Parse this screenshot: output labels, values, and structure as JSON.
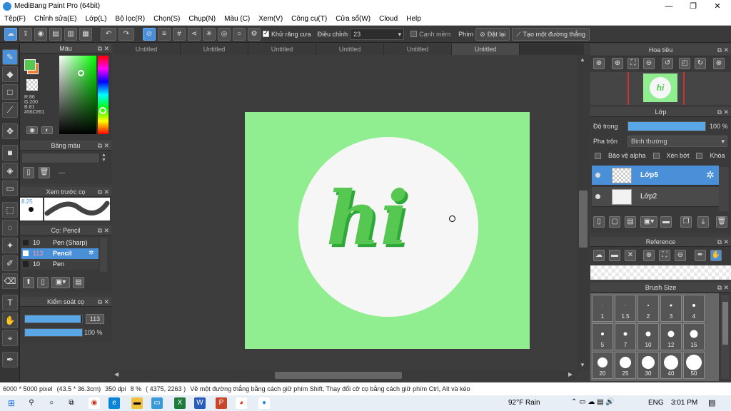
{
  "app": {
    "title": "MediBang Paint Pro (64bit)"
  },
  "menu": [
    "Tệp(F)",
    "Chỉnh sửa(E)",
    "Lớp(L)",
    "Bộ lọc(R)",
    "Chọn(S)",
    "Chụp(N)",
    "Màu (C)",
    "Xem(V)",
    "Công cụ(T)",
    "Cửa sổ(W)",
    "Cloud",
    "Help"
  ],
  "toolbar": {
    "antialias_label": "Khử răng cưa",
    "correction_label": "Điều chỉnh",
    "correction_value": "23",
    "soft_edge_label": "Cạnh mềm",
    "key_label": "Phím",
    "reset_label": "Đặt lại",
    "make_line_label": "Tạo một đường thẳng"
  },
  "tabs": [
    "Untitled",
    "Untitled",
    "Untitled",
    "Untitled",
    "Untitled",
    "Untitled"
  ],
  "color_panel": {
    "title": "Màu",
    "r": "R:86",
    "g": "G:200",
    "b": "B:81",
    "hex": "#56C851",
    "primary_color": "#56C851",
    "secondary_color": "#f07a30"
  },
  "palette_panel": {
    "title": "Bảng màu",
    "empty_label": "---"
  },
  "brush_preview_panel": {
    "title": "Xem trước cọ",
    "size_label": "8.25"
  },
  "brush_panel": {
    "title": "Cọ: Pencil",
    "items": [
      {
        "size": "10",
        "name": "Pen (Sharp)"
      },
      {
        "size": "113",
        "name": "Pencil"
      },
      {
        "size": "10",
        "name": "Pen"
      }
    ]
  },
  "brush_control_panel": {
    "title": "Kiểm soát cọ",
    "size_value": "113",
    "opacity_value": "100 %",
    "size_fraction": 0.97,
    "opacity_fraction": 1.0
  },
  "navigator_panel": {
    "title": "Hoa tiêu"
  },
  "layer_panel": {
    "title": "Lớp",
    "opacity_label": "Độ trong",
    "opacity_value": "100 %",
    "opacity_fraction": 1.0,
    "blend_label": "Pha trộn",
    "blend_value": "Bình thường",
    "protect_alpha": "Bảo vệ alpha",
    "clipping": "Xén bớt",
    "lock": "Khóa",
    "layers": [
      "Lớp5",
      "Lớp2"
    ]
  },
  "reference_panel": {
    "title": "Reference"
  },
  "brush_size_panel": {
    "title": "Brush Size",
    "sizes": [
      "1",
      "1.5",
      "2",
      "3",
      "4",
      "5",
      "7",
      "10",
      "12",
      "15",
      "20",
      "25",
      "30",
      "40",
      "50"
    ]
  },
  "canvas": {
    "text": "hi"
  },
  "status": {
    "dimensions": "6000 * 5000 pixel",
    "physical": "(43.5 * 36.3cm)",
    "dpi": "350 dpi",
    "zoom": "8 %",
    "coords": "( 4375, 2263 )",
    "hint": "Vẽ một đường thẳng bằng cách giữ phím Shift, Thay đổi cỡ cọ bằng cách giữ phím Ctrl, Alt và kéo"
  },
  "taskbar": {
    "weather": "92°F  Rain",
    "lang": "ENG",
    "time": "3:01 PM"
  }
}
